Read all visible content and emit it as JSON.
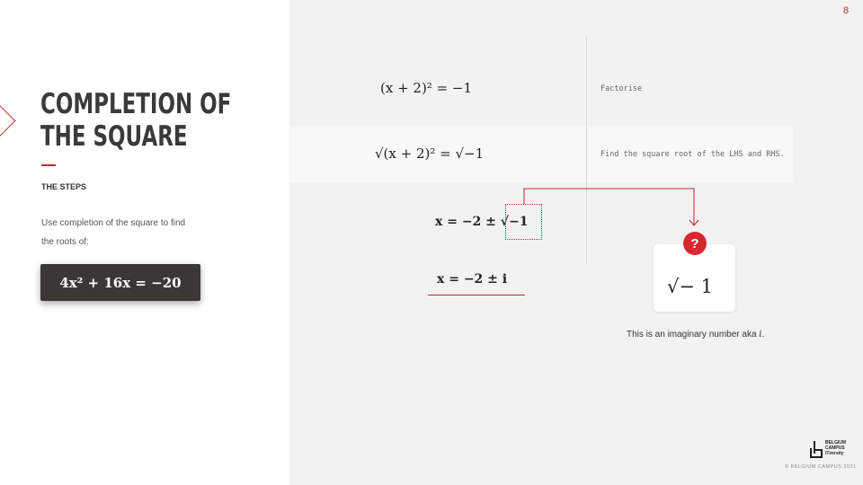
{
  "slide": {
    "page_number": "8",
    "title_line1": "COMPLETION OF",
    "title_line2": "THE SQUARE",
    "subtitle": "THE STEPS",
    "instruction": "Use completion of the square to find the roots of:",
    "equation": "4x² + 16x = −20"
  },
  "steps": [
    {
      "math": "(x + 2)² = −1",
      "note": "Factorise"
    },
    {
      "math": "√(x + 2)² = √−1",
      "note": "Find the square root of the LHS and RHS."
    },
    {
      "math": "x = −2 ± √−1",
      "note": ""
    },
    {
      "math": "x = −2 ± i",
      "note": ""
    }
  ],
  "callout": {
    "icon": "question-icon",
    "math": "√− 1",
    "caption_prefix": "This is an imaginary number aka ",
    "caption_var": "i",
    "caption_suffix": "."
  },
  "footer": {
    "logo_line1": "BELGIUM",
    "logo_line2": "CAMPUS",
    "logo_line3": "iTversity",
    "copyright": "© BELGIUM CAMPUS 2021"
  },
  "colors": {
    "accent": "#c0282d",
    "panel_bg": "#f2f2f2",
    "equation_box": "#3b3735"
  }
}
